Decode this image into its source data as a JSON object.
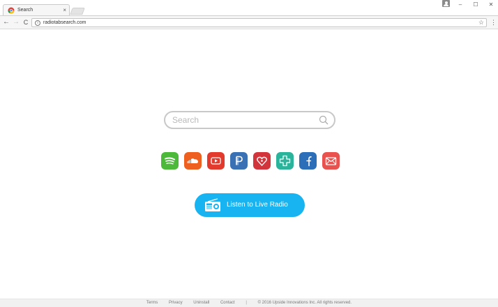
{
  "browser": {
    "tab_title": "Search",
    "tab_close": "×",
    "url": "radiotabsearch.com",
    "controls": {
      "minimize": "–",
      "maximize": "☐",
      "close": "✕"
    },
    "nav": {
      "back": "←",
      "forward": "→",
      "reload": "C"
    },
    "star": "☆",
    "menu": "⋮",
    "info": "i"
  },
  "search": {
    "placeholder": "Search"
  },
  "services": [
    {
      "name": "spotify",
      "icon": "spotify-icon",
      "color": "#4db93a"
    },
    {
      "name": "soundcloud",
      "icon": "soundcloud-icon",
      "color": "#ee6020"
    },
    {
      "name": "youtube",
      "icon": "youtube-icon",
      "color": "#e23b2e"
    },
    {
      "name": "pandora",
      "icon": "pandora-icon",
      "color": "#3a71b5"
    },
    {
      "name": "iheartradio",
      "icon": "iheartradio-icon",
      "color": "#d3353c"
    },
    {
      "name": "tunein",
      "icon": "tunein-icon",
      "color": "#2bb39c"
    },
    {
      "name": "facebook",
      "icon": "facebook-icon",
      "color": "#2c6eb8"
    },
    {
      "name": "email",
      "icon": "email-icon",
      "color": "#e8534f"
    }
  ],
  "radio_button": {
    "label": "Listen to Live Radio",
    "color": "#18b4f1"
  },
  "footer": {
    "terms": "Terms",
    "privacy": "Privacy",
    "uninstall": "Uninstall",
    "contact": "Contact",
    "separator": "|",
    "copyright": "© 2016 Upside Innovations Inc. All rights reserved."
  }
}
